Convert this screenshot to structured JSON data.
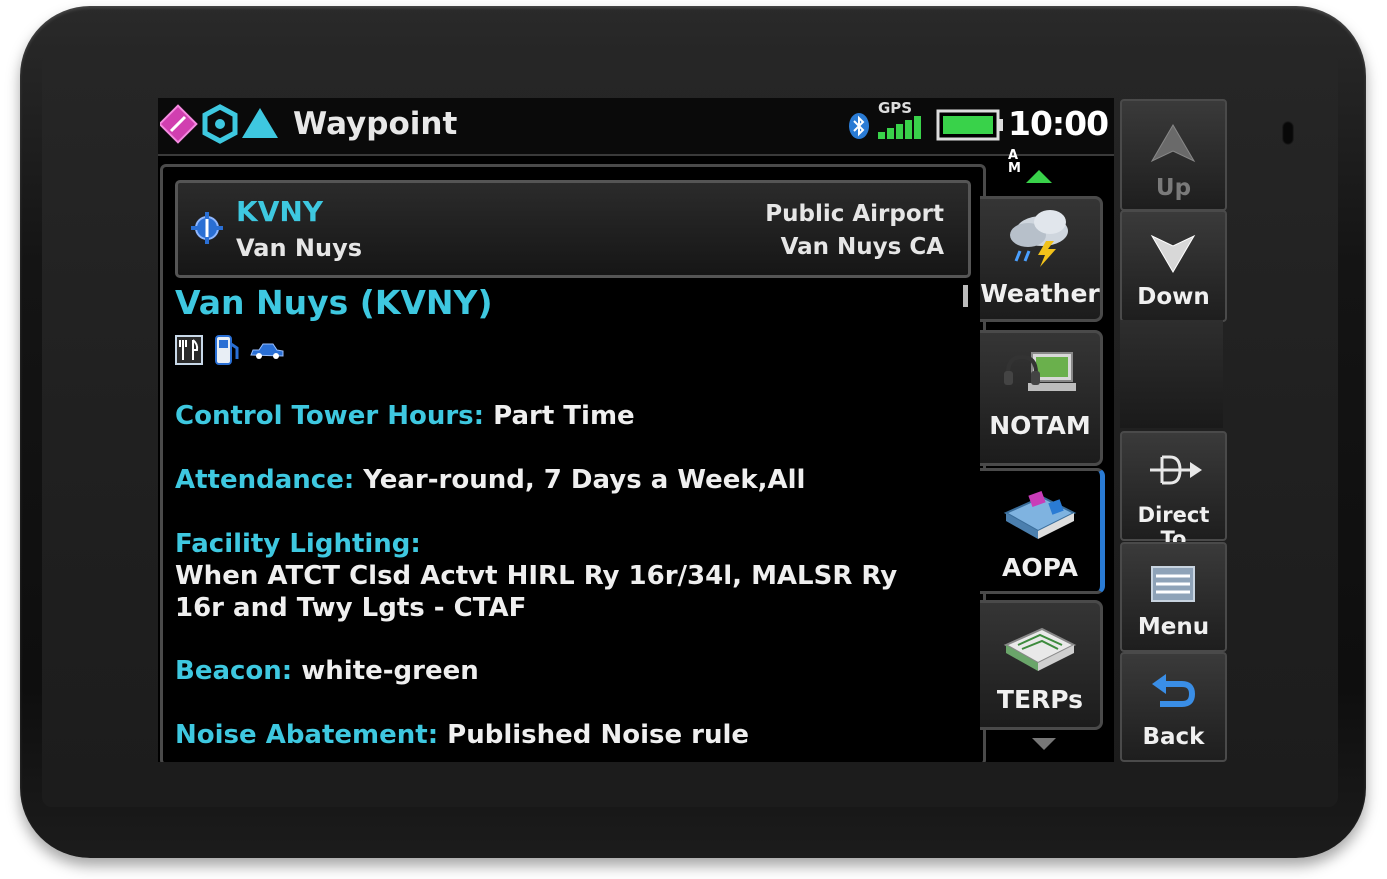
{
  "status_bar": {
    "title": "Waypoint",
    "gps_label": "GPS",
    "clock_time": "10:00",
    "clock_ampm_top": "A",
    "clock_ampm_bottom": "M",
    "battery_level": 0.9,
    "gps_signal_bars": 5
  },
  "waypoint_header": {
    "ident": "KVNY",
    "city": "Van Nuys",
    "type": "Public Airport",
    "location": "Van Nuys CA"
  },
  "airport": {
    "name": "Van Nuys (KVNY)",
    "amenity_icons": [
      "restaurant-icon",
      "fuel-pump-icon",
      "rental-car-icon"
    ]
  },
  "info": {
    "tower_label": "Control Tower Hours:",
    "tower_value": "Part Time",
    "attendance_label": "Attendance:",
    "attendance_value": "Year-round, 7 Days a Week,All",
    "lighting_label": "Facility Lighting:",
    "lighting_value_line1": "When ATCT Clsd Actvt HIRL Ry 16r/34l, MALSR Ry",
    "lighting_value_line2": "16r and Twy Lgts - CTAF",
    "beacon_label": "Beacon:",
    "beacon_value": "white-green",
    "noise_label": "Noise Abatement:",
    "noise_value": "Published Noise rule"
  },
  "tabs": {
    "weather": "Weather",
    "notam": "NOTAM",
    "aopa": "AOPA",
    "terps": "TERPs",
    "active": "AOPA"
  },
  "side_buttons": {
    "up": "Up",
    "down": "Down",
    "direct_to": "Direct To",
    "menu": "Menu",
    "back": "Back"
  },
  "colors": {
    "accent_cyan": "#3ec8e0",
    "battery_green": "#39d24a",
    "tab_active_blue": "#2a7bd4"
  }
}
